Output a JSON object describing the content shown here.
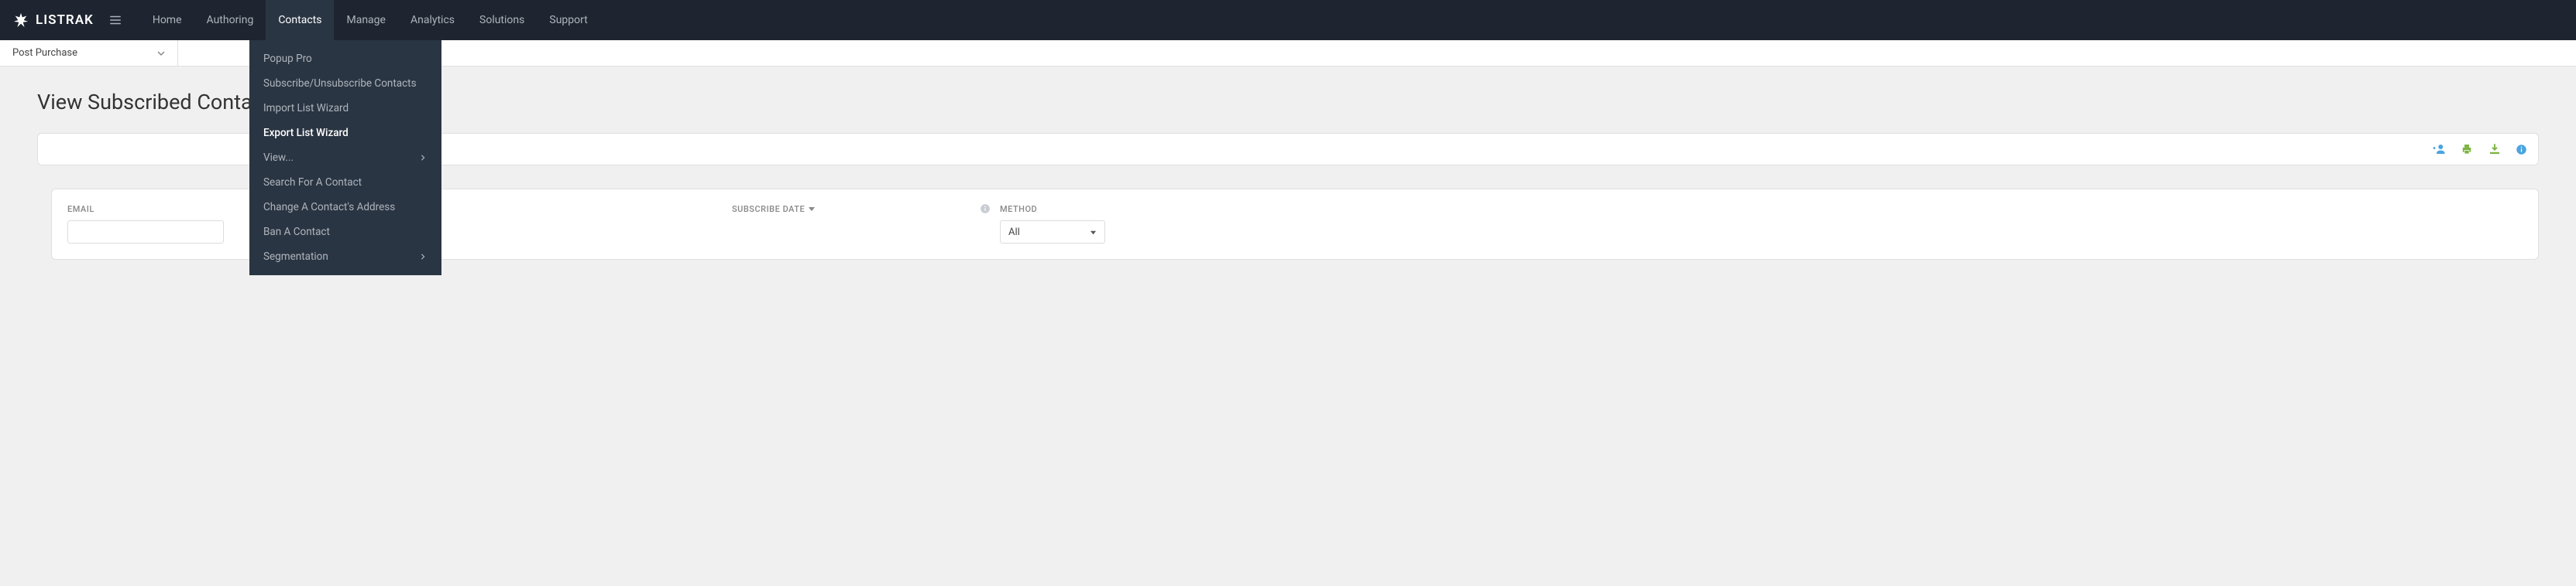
{
  "brand": "LISTRAK",
  "nav": {
    "items": [
      {
        "label": "Home",
        "active": false
      },
      {
        "label": "Authoring",
        "active": false
      },
      {
        "label": "Contacts",
        "active": true
      },
      {
        "label": "Manage",
        "active": false
      },
      {
        "label": "Analytics",
        "active": false
      },
      {
        "label": "Solutions",
        "active": false
      },
      {
        "label": "Support",
        "active": false
      }
    ]
  },
  "sub_nav": {
    "selected": "Post Purchase"
  },
  "dropdown": {
    "items": [
      {
        "label": "Popup Pro",
        "submenu": false,
        "highlighted": false
      },
      {
        "label": "Subscribe/Unsubscribe Contacts",
        "submenu": false,
        "highlighted": false
      },
      {
        "label": "Import List Wizard",
        "submenu": false,
        "highlighted": false
      },
      {
        "label": "Export List Wizard",
        "submenu": false,
        "highlighted": true
      },
      {
        "label": "View...",
        "submenu": true,
        "highlighted": false
      },
      {
        "label": "Search For A Contact",
        "submenu": false,
        "highlighted": false
      },
      {
        "label": "Change A Contact's Address",
        "submenu": false,
        "highlighted": false
      },
      {
        "label": "Ban A Contact",
        "submenu": false,
        "highlighted": false
      },
      {
        "label": "Segmentation",
        "submenu": true,
        "highlighted": false
      }
    ]
  },
  "page": {
    "title": "View Subscribed Contacts"
  },
  "table": {
    "columns": {
      "email": "EMAIL",
      "subscribe_date": "SUBSCRIBE DATE",
      "method": "METHOD"
    },
    "filters": {
      "email": "",
      "method_selected": "All"
    }
  },
  "colors": {
    "icon_blue": "#4aa4e0",
    "icon_green": "#7cb342",
    "icon_gray": "#9aa2ad"
  }
}
